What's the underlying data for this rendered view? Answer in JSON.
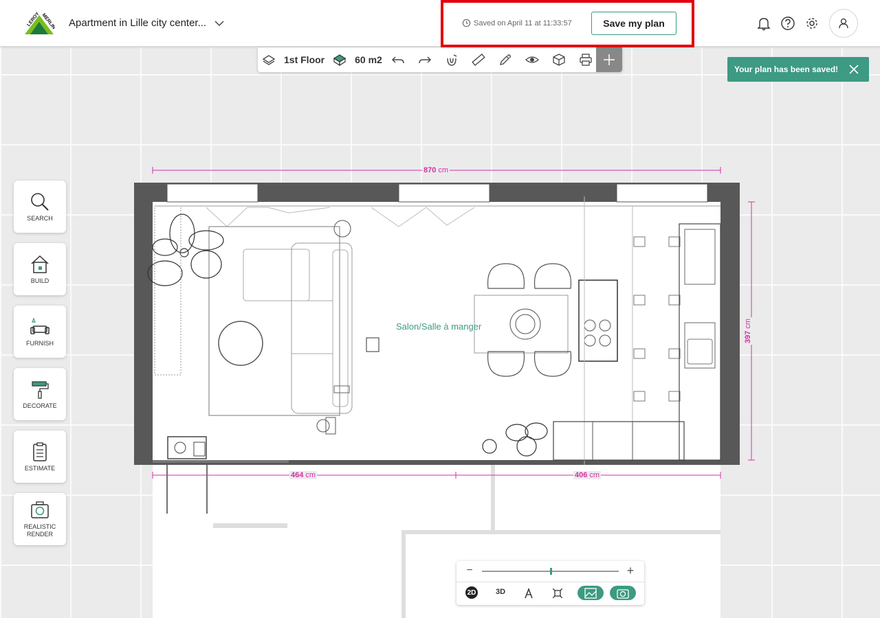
{
  "header": {
    "project_title": "Apartment in Lille city center...",
    "saved_status": "Saved on April 11 at 11:33:57",
    "save_label": "Save my plan"
  },
  "toolbar": {
    "floor_label": "1st Floor",
    "area_label": "60 m2"
  },
  "toast": {
    "message": "Your plan has been saved!"
  },
  "sidenav": {
    "search": "SEARCH",
    "build": "BUILD",
    "furnish": "FURNISH",
    "decorate": "DECORATE",
    "estimate": "ESTIMATE",
    "render_1": "REALISTIC",
    "render_2": "RENDER"
  },
  "plan": {
    "room_label": "Salon/Salle à manger",
    "dim_top": "870",
    "dim_bottom_left": "464",
    "dim_bottom_right": "406",
    "dim_right": "397",
    "unit": "cm"
  },
  "zoom": {
    "level": 0.5,
    "view_2d": "2D",
    "view_3d": "3D"
  },
  "colors": {
    "accent": "#3d9a83",
    "dimension": "#d62fa8",
    "highlight": "#e3000b"
  }
}
